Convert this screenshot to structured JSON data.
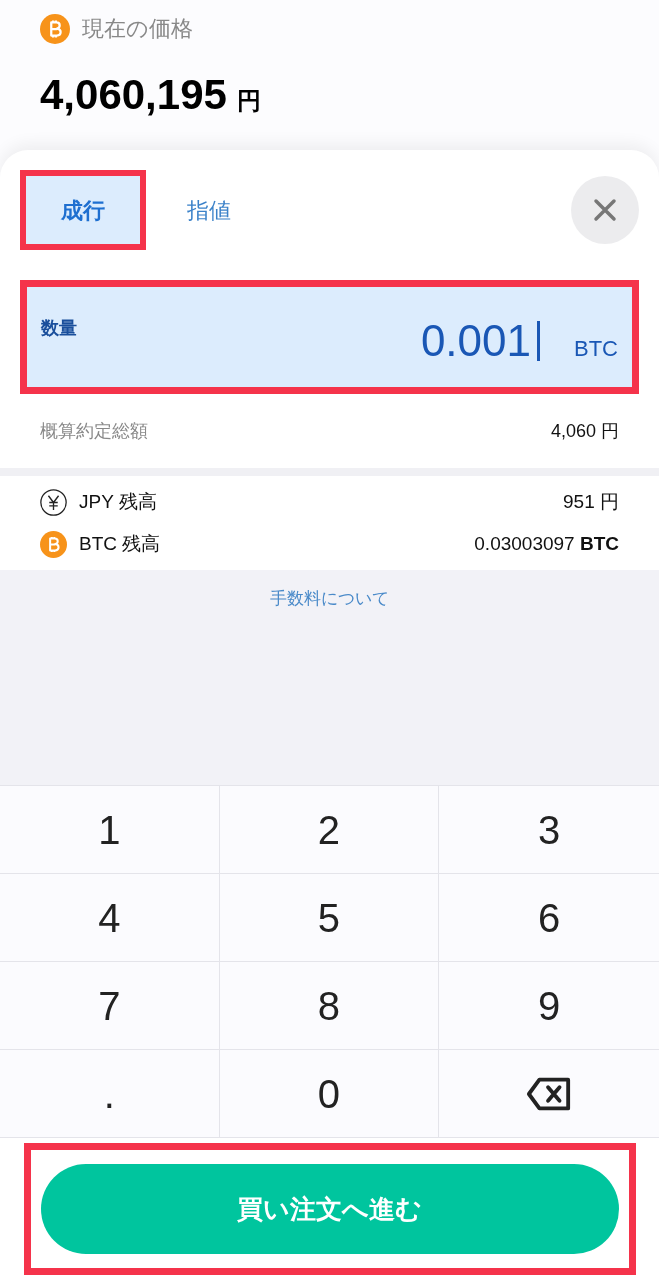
{
  "price": {
    "label": "現在の価格",
    "value": "4,060,195",
    "unit": "円"
  },
  "tabs": [
    {
      "label": "成行",
      "selected": true,
      "highlighted": true
    },
    {
      "label": "指値",
      "selected": false,
      "highlighted": false
    }
  ],
  "quantity": {
    "label": "数量",
    "value": "0.001",
    "unit": "BTC",
    "focused": true,
    "highlighted": true
  },
  "estimate": {
    "label": "概算約定総額",
    "value": "4,060 円"
  },
  "balances": [
    {
      "kind": "jpy",
      "label": "JPY 残高",
      "value": "951 円"
    },
    {
      "kind": "btc",
      "label": "BTC 残高",
      "value": "0.03003097",
      "unit": "BTC"
    }
  ],
  "fee_link": "手数料について",
  "keypad": [
    {
      "kind": "digit",
      "label": "1"
    },
    {
      "kind": "digit",
      "label": "2"
    },
    {
      "kind": "digit",
      "label": "3"
    },
    {
      "kind": "digit",
      "label": "4"
    },
    {
      "kind": "digit",
      "label": "5"
    },
    {
      "kind": "digit",
      "label": "6"
    },
    {
      "kind": "digit",
      "label": "7"
    },
    {
      "kind": "digit",
      "label": "8"
    },
    {
      "kind": "digit",
      "label": "9"
    },
    {
      "kind": "digit",
      "label": "."
    },
    {
      "kind": "digit",
      "label": "0"
    },
    {
      "kind": "backspace"
    }
  ],
  "submit": {
    "label": "買い注文へ進む",
    "highlighted": true
  }
}
